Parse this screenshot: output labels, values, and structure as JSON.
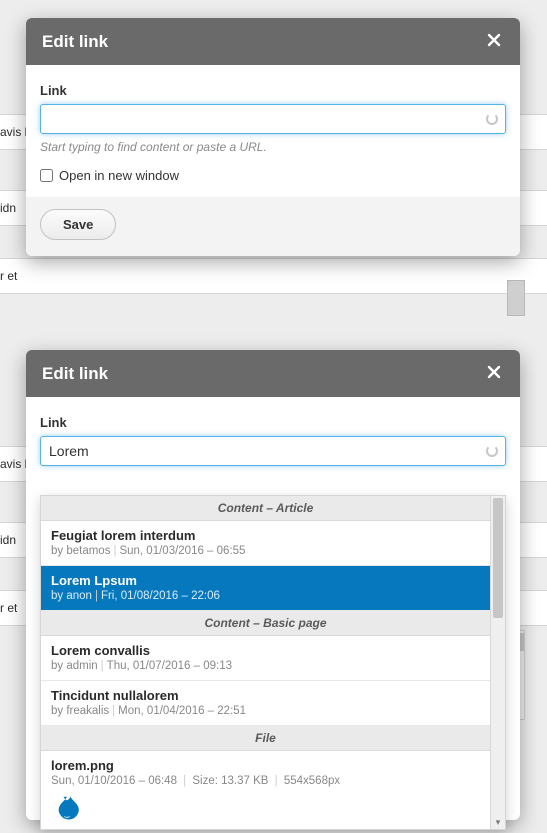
{
  "bg": {
    "row1": "avis l",
    "row2": "idn",
    "row3": "r et"
  },
  "modal1": {
    "title": "Edit link",
    "link_label": "Link",
    "link_value": "",
    "hint": "Start typing to find content or paste a URL.",
    "open_new_window_label": "Open in new window",
    "save_label": "Save"
  },
  "modal2": {
    "title": "Edit link",
    "link_label": "Link",
    "link_value": "Lorem",
    "dropdown": {
      "groups": [
        {
          "header": "Content – Article",
          "items": [
            {
              "title": "Feugiat lorem interdum",
              "by": "by betamos",
              "date": "Sun, 01/03/2016 – 06:55",
              "selected": false
            },
            {
              "title": "Lorem Lpsum",
              "by": "by anon",
              "date": "Fri, 01/08/2016 – 22:06",
              "selected": true
            }
          ]
        },
        {
          "header": "Content – Basic page",
          "items": [
            {
              "title": "Lorem convallis",
              "by": "by admin",
              "date": "Thu, 01/07/2016 – 09:13",
              "selected": false
            },
            {
              "title": "Tincidunt nullalorem",
              "by": "by freakalis",
              "date": "Mon, 01/04/2016 – 22:51",
              "selected": false
            }
          ]
        },
        {
          "header": "File",
          "items": [
            {
              "title": "lorem.png",
              "meta_line": "Sun, 01/10/2016 – 06:48 | Size: 13.37 KB | 554x568px",
              "is_file": true,
              "selected": false
            }
          ]
        }
      ]
    }
  }
}
